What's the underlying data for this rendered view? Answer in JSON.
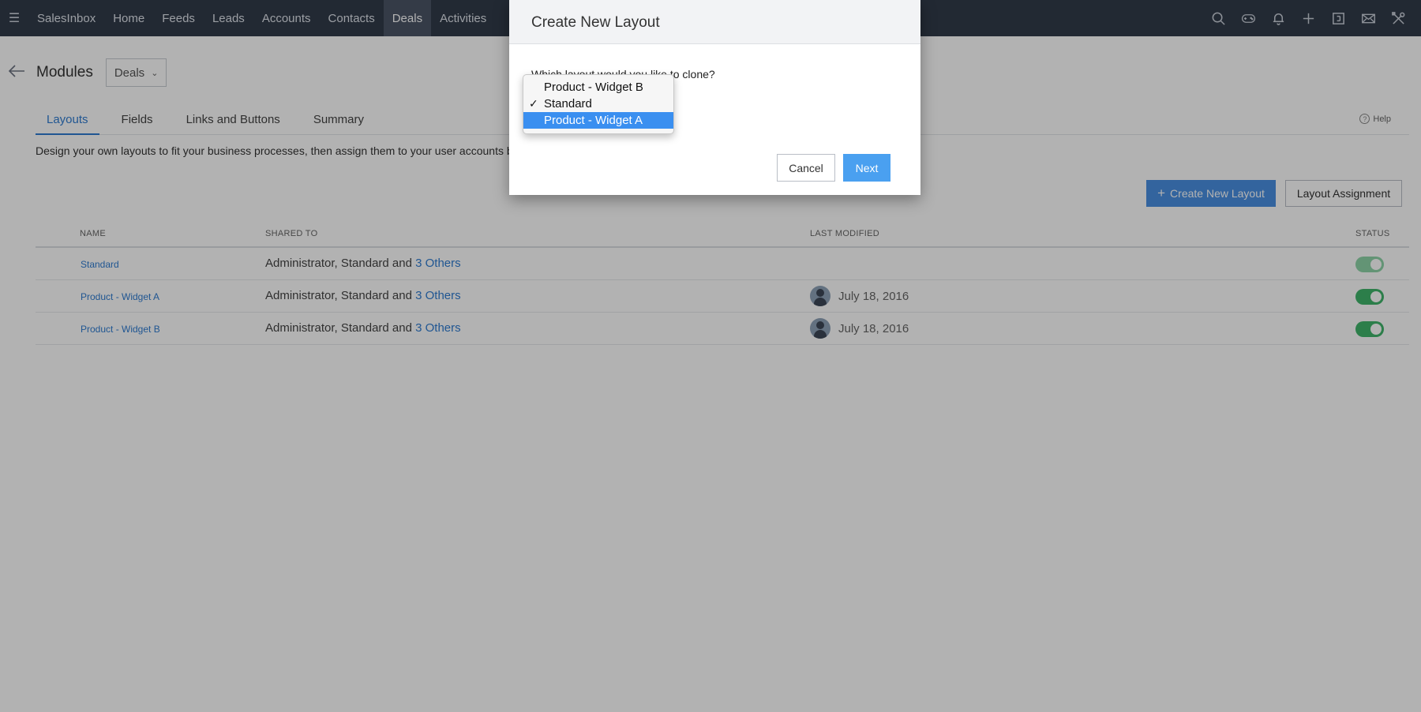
{
  "nav": {
    "menu_icon": "hamburger-icon",
    "items": [
      {
        "label": "SalesInbox",
        "active": false
      },
      {
        "label": "Home",
        "active": false
      },
      {
        "label": "Feeds",
        "active": false
      },
      {
        "label": "Leads",
        "active": false
      },
      {
        "label": "Accounts",
        "active": false
      },
      {
        "label": "Contacts",
        "active": false
      },
      {
        "label": "Deals",
        "active": true
      },
      {
        "label": "Activities",
        "active": false
      }
    ],
    "right_icons": [
      "search-icon",
      "gamepad-icon",
      "bell-icon",
      "plus-icon",
      "calendar-icon",
      "mail-icon",
      "tools-icon"
    ]
  },
  "page": {
    "title": "Modules",
    "module_selected": "Deals",
    "tabs": [
      {
        "label": "Layouts",
        "active": true
      },
      {
        "label": "Fields",
        "active": false
      },
      {
        "label": "Links and Buttons",
        "active": false
      },
      {
        "label": "Summary",
        "active": false
      }
    ],
    "help_label": "Help",
    "description": "Design your own layouts to fit your business processes, then assign them to your user accounts b",
    "create_button": "Create New Layout",
    "assign_button": "Layout Assignment"
  },
  "table": {
    "columns": {
      "name": "NAME",
      "shared": "SHARED TO",
      "modified": "LAST MODIFIED",
      "status": "STATUS"
    },
    "rows": [
      {
        "name": "Standard",
        "shared_prefix": "Administrator, Standard and ",
        "shared_link": "3 Others",
        "modified": "",
        "status_on": true
      },
      {
        "name": "Product - Widget A",
        "shared_prefix": "Administrator, Standard and ",
        "shared_link": "3 Others",
        "modified": "July 18, 2016",
        "status_on": true
      },
      {
        "name": "Product - Widget B",
        "shared_prefix": "Administrator, Standard and ",
        "shared_link": "3 Others",
        "modified": "July 18, 2016",
        "status_on": true
      }
    ]
  },
  "modal": {
    "title": "Create New Layout",
    "question": "Which layout would you like to clone?",
    "cancel_label": "Cancel",
    "next_label": "Next",
    "dropdown": {
      "options": [
        "Product - Widget B",
        "Standard",
        "Product - Widget A"
      ],
      "checked": "Standard",
      "highlighted": "Product - Widget A"
    }
  },
  "colors": {
    "nav_bg": "#313b4a",
    "accent": "#2f7cd1",
    "primary_button": "#4a90e2",
    "toggle_on": "#3fb56a",
    "dropdown_highlight": "#3a8ff0"
  }
}
